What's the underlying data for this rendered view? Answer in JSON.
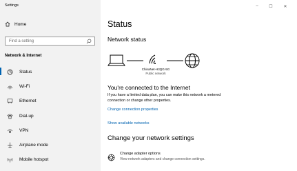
{
  "window": {
    "title": "Settings",
    "minimize_glyph": "–",
    "maximize_glyph": "☐",
    "close_glyph": "✕"
  },
  "sidebar": {
    "home_label": "Home",
    "search_placeholder": "Find a setting",
    "section_title": "Network & Internet",
    "items": [
      {
        "label": "Status",
        "icon": "status-icon",
        "active": true
      },
      {
        "label": "Wi-Fi",
        "icon": "wifi-icon",
        "active": false
      },
      {
        "label": "Ethernet",
        "icon": "ethernet-icon",
        "active": false
      },
      {
        "label": "Dial-up",
        "icon": "dialup-icon",
        "active": false
      },
      {
        "label": "VPN",
        "icon": "vpn-icon",
        "active": false
      },
      {
        "label": "Airplane mode",
        "icon": "airplane-icon",
        "active": false
      },
      {
        "label": "Mobile hotspot",
        "icon": "hotspot-icon",
        "active": false
      }
    ]
  },
  "main": {
    "title": "Status",
    "network_status_heading": "Network status",
    "network_name": "ChinaNet-H3QG-5G",
    "network_type": "Public network",
    "connected_heading": "You're connected to the Internet",
    "connected_desc": "If you have a limited data plan, you can make this network a metered connection or change other properties.",
    "link_change_properties": "Change connection properties",
    "link_show_networks": "Show available networks",
    "change_settings_heading": "Change your network settings",
    "adapter_title": "Change adapter options",
    "adapter_desc": "View network adapters and change connection settings."
  },
  "colors": {
    "accent": "#0063b1",
    "sidebar_bg": "#f2f2f2"
  }
}
